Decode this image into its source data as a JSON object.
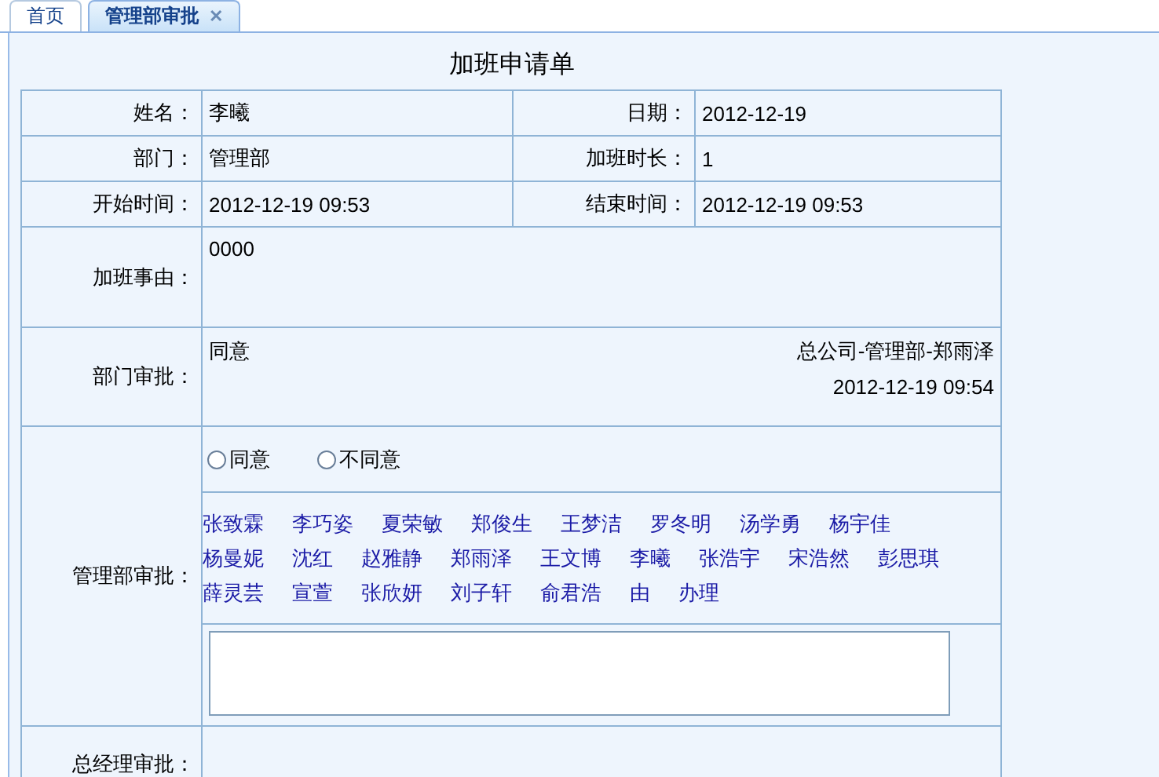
{
  "tabs": [
    {
      "label": "首页",
      "selected": false,
      "closable": false
    },
    {
      "label": "管理部审批",
      "selected": true,
      "closable": true
    }
  ],
  "tab_close_glyph": "✕",
  "form": {
    "title": "加班申请单",
    "fields": [
      [
        {
          "label": "姓名：",
          "value": "李曦"
        },
        {
          "label": "日期：",
          "value": "2012-12-19"
        }
      ],
      [
        {
          "label": "部门：",
          "value": "管理部"
        },
        {
          "label": "加班时长：",
          "value": "1"
        }
      ],
      [
        {
          "label": "开始时间：",
          "value": "2012-12-19 09:53"
        },
        {
          "label": "结束时间：",
          "value": "2012-12-19 09:53"
        }
      ]
    ],
    "reason": {
      "label": "加班事由：",
      "value": "0000"
    },
    "dept_approval": {
      "label": "部门审批：",
      "opinion": "同意",
      "signer": "总公司-管理部-郑雨泽",
      "time": "2012-12-19 09:54"
    },
    "mgmt_approval": {
      "label": "管理部审批：",
      "options": [
        {
          "label": "同意",
          "selected": false
        },
        {
          "label": "不同意",
          "selected": false
        }
      ],
      "names": [
        "张致霖",
        "李巧姿",
        "夏荣敏",
        "郑俊生",
        "王梦洁",
        "罗冬明",
        "汤学勇",
        "杨宇佳",
        "杨曼妮",
        "沈红",
        "赵雅静",
        "郑雨泽",
        "王文博",
        "李曦",
        "张浩宇",
        "宋浩然",
        "彭思琪",
        "薛灵芸",
        "宣萱",
        "张欣妍",
        "刘子轩",
        "俞君浩",
        "由",
        "办理"
      ]
    },
    "gm_approval": {
      "label": "总经理审批："
    }
  }
}
